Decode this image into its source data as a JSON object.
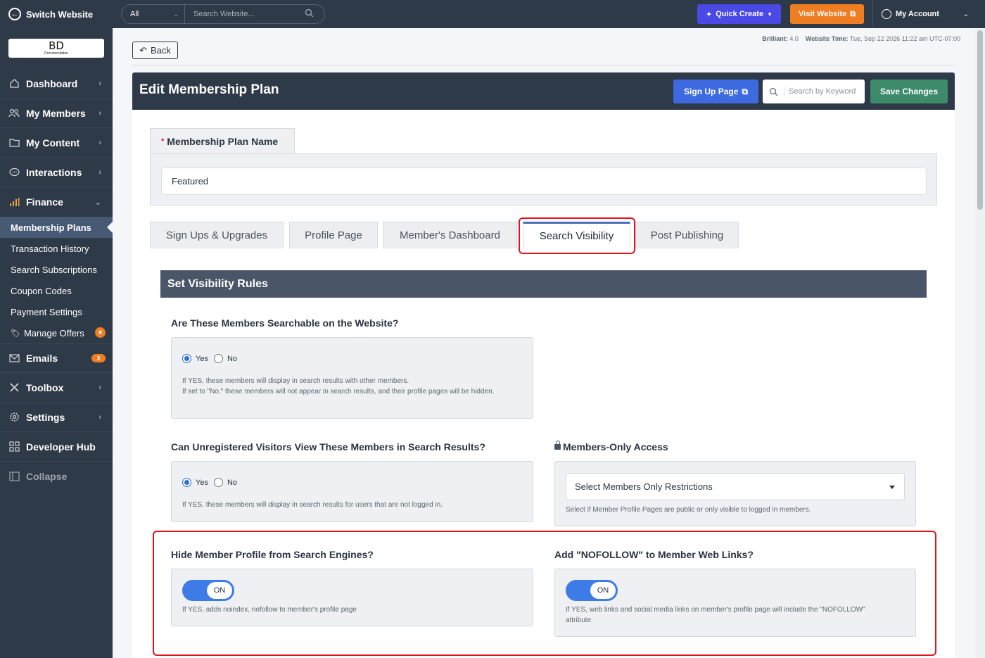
{
  "topbar": {
    "switch_website": "Switch Website",
    "search_scope": "All",
    "search_placeholder": "Search Website...",
    "quick_create": "Quick Create",
    "visit_website": "Visit Website",
    "my_account": "My Account"
  },
  "logo": {
    "line1": "BD",
    "line2": "Documentation"
  },
  "sidebar": {
    "items": [
      {
        "label": "Dashboard",
        "icon": "home-icon"
      },
      {
        "label": "My Members",
        "icon": "users-icon"
      },
      {
        "label": "My Content",
        "icon": "folder-icon"
      },
      {
        "label": "Interactions",
        "icon": "chat-icon"
      },
      {
        "label": "Finance",
        "icon": "bar-chart-icon"
      }
    ],
    "finance_sub": [
      "Membership Plans",
      "Transaction History",
      "Search Subscriptions",
      "Coupon Codes",
      "Payment Settings",
      "Manage Offers"
    ],
    "items2": [
      {
        "label": "Emails",
        "icon": "mail-icon",
        "badge": "3"
      },
      {
        "label": "Toolbox",
        "icon": "tools-icon"
      },
      {
        "label": "Settings",
        "icon": "gear-icon"
      },
      {
        "label": "Developer Hub",
        "icon": "grid-icon"
      },
      {
        "label": "Collapse",
        "icon": "collapse-icon"
      }
    ]
  },
  "header": {
    "back": "Back",
    "meta_brilliant_label": "Brilliant:",
    "meta_brilliant_value": "4.0",
    "meta_time_label": "Website Time:",
    "meta_time_value": "Tue, Sep 22 2026 11:22 am UTC-07:00"
  },
  "panel": {
    "title": "Edit Membership Plan",
    "signup_page": "Sign Up Page",
    "keyword_placeholder": "Search by Keyword",
    "save_changes": "Save Changes"
  },
  "plan_name": {
    "required_mark": "*",
    "label": "Membership Plan Name",
    "value": "Featured"
  },
  "tabs": [
    "Sign Ups & Upgrades",
    "Profile Page",
    "Member's Dashboard",
    "Search Visibility",
    "Post Publishing"
  ],
  "section_title": "Set Visibility Rules",
  "q1": {
    "label": "Are These Members Searchable on the Website?",
    "yes": "Yes",
    "no": "No",
    "selected": "Yes",
    "help1": "If YES, these members will display in search results with other members.",
    "help2": "If set to \"No,\" these members will not appear in search results, and their profile pages will be hidden."
  },
  "q2": {
    "label": "Can Unregistered Visitors View These Members in Search Results?",
    "yes": "Yes",
    "no": "No",
    "selected": "Yes",
    "help": "If YES, these members will display in search results for users that are not logged in."
  },
  "q3": {
    "label": "Members-Only Access",
    "select_value": "Select Members Only Restrictions",
    "help": "Select if Member Profile Pages are public or only visible to logged in members."
  },
  "q4": {
    "label": "Hide Member Profile from Search Engines?",
    "toggle": "ON",
    "help": "If YES, adds noindex, nofollow to member's profile page"
  },
  "q5": {
    "label": "Add \"NOFOLLOW\" to Member Web Links?",
    "toggle": "ON",
    "help1": "If YES, web links and social media links on member's profile page will include the \"NOFOLLOW\"",
    "help2": "attribute"
  },
  "colors": {
    "sidebar": "#2f3a48",
    "primary": "#3d6ae0",
    "save": "#3e8b6c",
    "orange": "#ef7d22",
    "highlight": "#e1141e"
  }
}
